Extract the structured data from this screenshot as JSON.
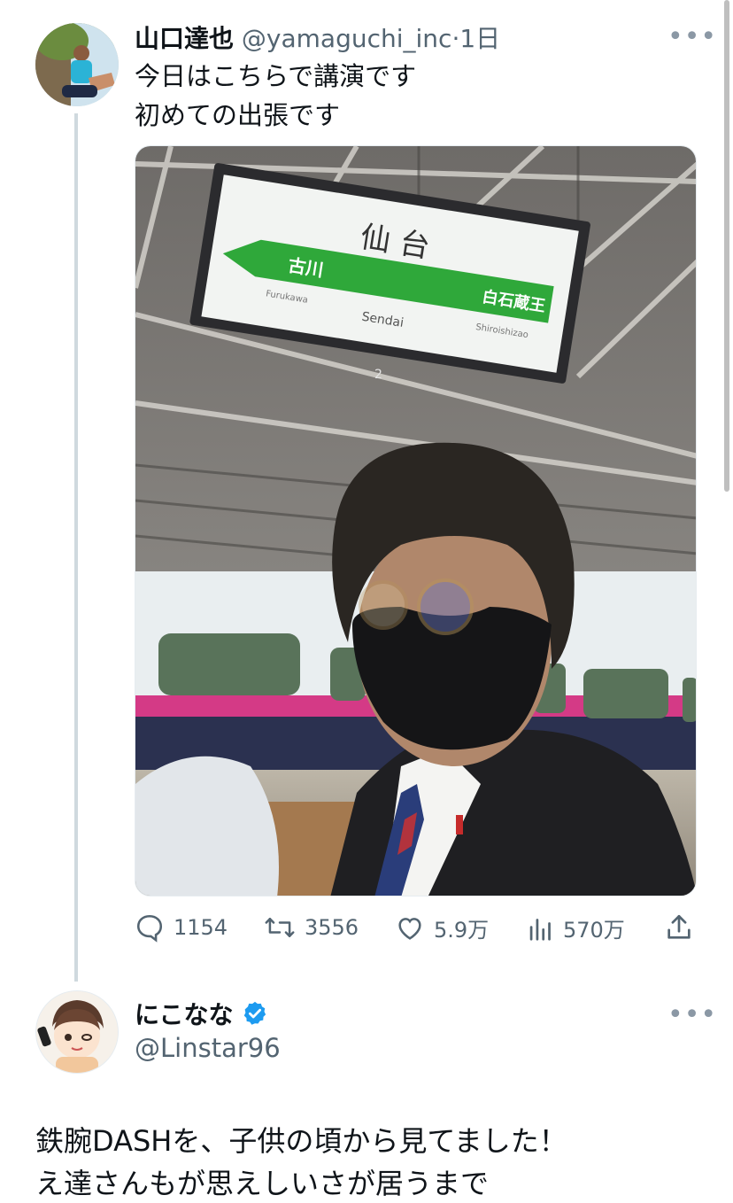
{
  "tweet1": {
    "author_name": "山口達也",
    "handle": "@yamaguchi_inc",
    "separator": "·",
    "time": "1日",
    "more": "•••",
    "text_line1": "今日はこちらで講演です",
    "text_line2": "初めての出張です",
    "photo": {
      "sign_station": "仙 台",
      "sign_romaji": "Sendai",
      "sign_left_station": "古川",
      "sign_left_romaji": "Furukawa",
      "sign_right_station": "白石蔵王",
      "sign_right_romaji": "Shiroishizao",
      "sign_number": "2"
    },
    "actions": {
      "replies": "1154",
      "retweets": "3556",
      "likes": "5.9万",
      "views": "570万"
    },
    "icons": [
      "reply-icon",
      "retweet-icon",
      "like-icon",
      "views-icon",
      "share-icon"
    ]
  },
  "tweet2": {
    "author_name": "にこなな",
    "handle": "@Linstar96",
    "more": "•••",
    "verified_color": "#1d9bf0",
    "reply_line1": "鉄腕DASHを、子供の頃から見てました！",
    "reply_line2": "え達さんもが思えしいさが居うまで"
  },
  "colors": {
    "accent": "#1d9bf0",
    "text": "#0f1419",
    "muted": "#536471",
    "sign_green": "#2fa83a"
  }
}
